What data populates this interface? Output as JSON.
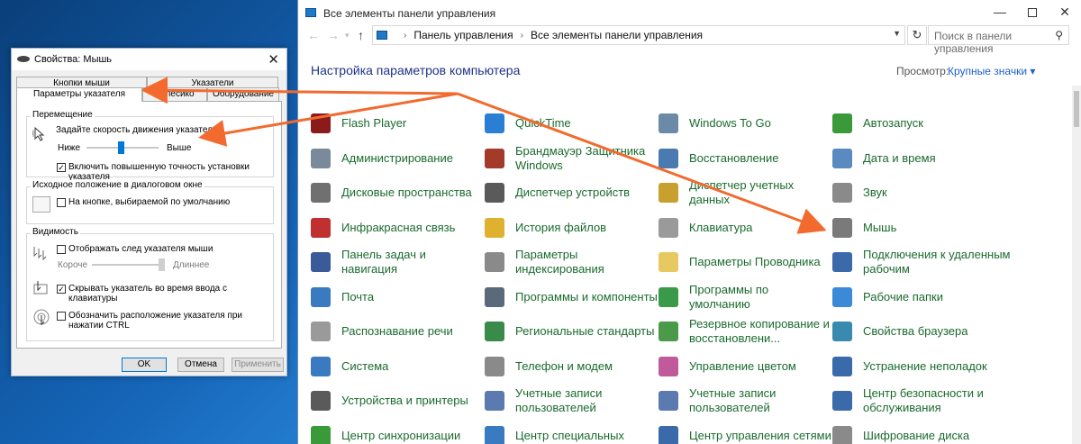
{
  "control_panel": {
    "window_title": "Все элементы панели управления",
    "breadcrumb": [
      "Панель управления",
      "Все элементы панели управления"
    ],
    "search_placeholder": "Поиск в панели управления",
    "heading": "Настройка параметров компьютера",
    "view_label": "Просмотр:",
    "view_value": "Крупные значки ▾",
    "items": [
      {
        "label": "Flash Player",
        "icon": "flash-player-icon",
        "color": "#8b1a1a"
      },
      {
        "label": "QuickTime",
        "icon": "quicktime-icon",
        "color": "#2a7fd4"
      },
      {
        "label": "Windows To Go",
        "icon": "usb-drive-icon",
        "color": "#6b8aa8"
      },
      {
        "label": "Автозапуск",
        "icon": "autoplay-icon",
        "color": "#3a9a3a"
      },
      {
        "label": "Администрирование",
        "icon": "admin-tools-icon",
        "color": "#7a8a9a"
      },
      {
        "label": "Брандмауэр Защитника Windows",
        "icon": "firewall-icon",
        "color": "#a33a2a"
      },
      {
        "label": "Восстановление",
        "icon": "recovery-icon",
        "color": "#4a7ab0"
      },
      {
        "label": "Дата и время",
        "icon": "calendar-clock-icon",
        "color": "#5a8ac0"
      },
      {
        "label": "Дисковые пространства",
        "icon": "storage-spaces-icon",
        "color": "#707070"
      },
      {
        "label": "Диспетчер устройств",
        "icon": "device-manager-icon",
        "color": "#5a5a5a"
      },
      {
        "label": "Диспетчер учетных данных",
        "icon": "credential-manager-icon",
        "color": "#c8a030"
      },
      {
        "label": "Звук",
        "icon": "speaker-icon",
        "color": "#8a8a8a"
      },
      {
        "label": "Инфракрасная связь",
        "icon": "infrared-icon",
        "color": "#c03030"
      },
      {
        "label": "История файлов",
        "icon": "file-history-icon",
        "color": "#e0b030"
      },
      {
        "label": "Клавиатура",
        "icon": "keyboard-icon",
        "color": "#9a9a9a"
      },
      {
        "label": "Мышь",
        "icon": "mouse-icon",
        "color": "#7a7a7a"
      },
      {
        "label": "Панель задач и навигация",
        "icon": "taskbar-icon",
        "color": "#3a5a9a"
      },
      {
        "label": "Параметры индексирования",
        "icon": "indexing-icon",
        "color": "#8a8a8a"
      },
      {
        "label": "Параметры Проводника",
        "icon": "folder-options-icon",
        "color": "#e8c860"
      },
      {
        "label": "Подключения к удаленным рабочим",
        "icon": "remote-desktop-icon",
        "color": "#3a6aaa"
      },
      {
        "label": "Почта",
        "icon": "mail-icon",
        "color": "#3a7ac0"
      },
      {
        "label": "Программы и компоненты",
        "icon": "programs-icon",
        "color": "#5a6a7a"
      },
      {
        "label": "Программы по умолчанию",
        "icon": "default-programs-icon",
        "color": "#3a9a4a"
      },
      {
        "label": "Рабочие папки",
        "icon": "work-folders-icon",
        "color": "#3a8ad8"
      },
      {
        "label": "Распознавание речи",
        "icon": "microphone-icon",
        "color": "#9a9a9a"
      },
      {
        "label": "Региональные стандарты",
        "icon": "region-icon",
        "color": "#3a8a4a"
      },
      {
        "label": "Резервное копирование и восстановлени...",
        "icon": "backup-icon",
        "color": "#4a9a4a"
      },
      {
        "label": "Свойства браузера",
        "icon": "internet-options-icon",
        "color": "#3a8ab0"
      },
      {
        "label": "Система",
        "icon": "system-icon",
        "color": "#3a7ac0"
      },
      {
        "label": "Телефон и модем",
        "icon": "phone-modem-icon",
        "color": "#8a8a8a"
      },
      {
        "label": "Управление цветом",
        "icon": "color-management-icon",
        "color": "#c05a9a"
      },
      {
        "label": "Устранение неполадок",
        "icon": "troubleshooting-icon",
        "color": "#3a6aaa"
      },
      {
        "label": "Устройства и принтеры",
        "icon": "printer-icon",
        "color": "#5a5a5a"
      },
      {
        "label": "Учетные записи пользователей",
        "icon": "users-icon",
        "color": "#5a7ab0"
      },
      {
        "label": "Учетные записи пользователей",
        "icon": "users-icon",
        "color": "#5a7ab0"
      },
      {
        "label": "Центр безопасности и обслуживания",
        "icon": "security-flag-icon",
        "color": "#3a6aaa"
      },
      {
        "label": "Центр синхронизации",
        "icon": "sync-center-icon",
        "color": "#3a9a3a"
      },
      {
        "label": "Центр специальных",
        "icon": "accessibility-icon",
        "color": "#3a7ac0"
      },
      {
        "label": "Центр управления сетями",
        "icon": "network-center-icon",
        "color": "#3a6aaa"
      },
      {
        "label": "Шифрование диска",
        "icon": "bitlocker-icon",
        "color": "#8a8a8a"
      }
    ]
  },
  "mouse_dialog": {
    "title": "Свойства: Мышь",
    "tabs_top": [
      "Кнопки мыши",
      "Указатели"
    ],
    "tabs_bottom": [
      "Параметры указателя",
      "Колесико",
      "Оборудование"
    ],
    "motion": {
      "group": "Перемещение",
      "speed_label": "Задайте скорость движения указателя:",
      "slow": "Ниже",
      "fast": "Выше",
      "precision": "Включить повышенную точность установки указателя",
      "precision_checked": "✓"
    },
    "snap": {
      "group": "Исходное положение в диалоговом окне",
      "label": "На кнопке, выбираемой по умолчанию"
    },
    "visibility": {
      "group": "Видимость",
      "trails": "Отображать след указателя мыши",
      "short": "Короче",
      "long": "Длиннее",
      "hide_typing": "Скрывать указатель во время ввода с клавиатуры",
      "hide_checked": "✓",
      "ctrl": "Обозначить расположение указателя при нажатии CTRL"
    },
    "buttons": {
      "ok": "OK",
      "cancel": "Отмена",
      "apply": "Применить"
    }
  },
  "colors": {
    "link_green": "#1a6a2e",
    "heading_blue": "#1e3287",
    "arrow_orange": "#f26a2e"
  }
}
